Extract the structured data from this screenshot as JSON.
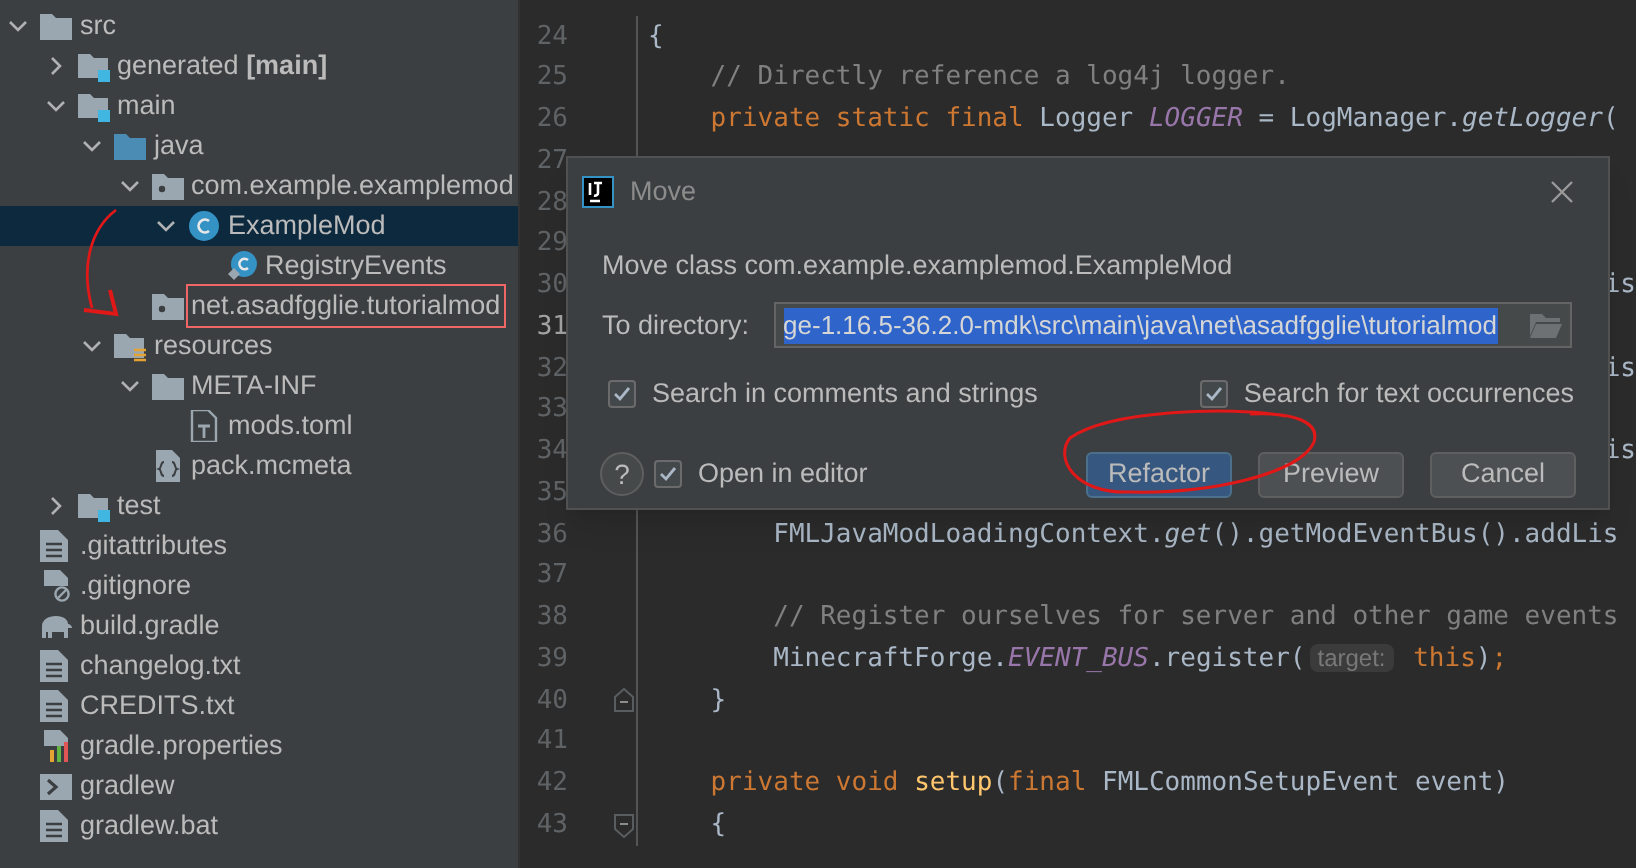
{
  "project_tree": [
    {
      "label": "src",
      "kind": "folder",
      "expanded": true,
      "selected": false,
      "children": [
        {
          "label": "generated **[main]**",
          "kind": "module_folder",
          "expanded": false,
          "selected": false
        },
        {
          "label": "main",
          "kind": "module_folder",
          "expanded": true,
          "selected": false,
          "children": [
            {
              "label": "java",
              "kind": "source_folder",
              "expanded": true,
              "selected": false,
              "children": [
                {
                  "label": "com.example.examplemod",
                  "kind": "package",
                  "expanded": true,
                  "selected": false,
                  "children": [
                    {
                      "label": "ExampleMod",
                      "kind": "class",
                      "expanded": true,
                      "selected": true,
                      "children": [
                        {
                          "label": "RegistryEvents",
                          "kind": "inner_class",
                          "selected": false
                        }
                      ]
                    }
                  ]
                },
                {
                  "label": "net.asadfgglie.tutorialmod",
                  "kind": "package",
                  "selected": false,
                  "annotated": true
                }
              ]
            },
            {
              "label": "resources",
              "kind": "resources_folder",
              "expanded": true,
              "selected": false,
              "children": [
                {
                  "label": "META-INF",
                  "kind": "folder",
                  "expanded": true,
                  "selected": false,
                  "children": [
                    {
                      "label": "mods.toml",
                      "kind": "toml_file",
                      "selected": false
                    }
                  ]
                },
                {
                  "label": "pack.mcmeta",
                  "kind": "json_file",
                  "selected": false
                }
              ]
            }
          ]
        },
        {
          "label": "test",
          "kind": "module_folder",
          "expanded": false,
          "selected": false
        }
      ]
    },
    {
      "label": ".gitattributes",
      "kind": "text_file",
      "selected": false
    },
    {
      "label": ".gitignore",
      "kind": "ignore_file",
      "selected": false
    },
    {
      "label": "build.gradle",
      "kind": "gradle_file",
      "selected": false
    },
    {
      "label": "changelog.txt",
      "kind": "text_file",
      "selected": false
    },
    {
      "label": "CREDITS.txt",
      "kind": "text_file",
      "selected": false
    },
    {
      "label": "gradle.properties",
      "kind": "properties_file",
      "selected": false
    },
    {
      "label": "gradlew",
      "kind": "script_file",
      "selected": false
    },
    {
      "label": "gradlew.bat",
      "kind": "text_file",
      "selected": false
    }
  ],
  "editor_lines": [
    {
      "number": "24",
      "current": false,
      "kind": "plain",
      "segments": [
        {
          "kind": "plain",
          "text": "{"
        }
      ]
    },
    {
      "number": "25",
      "current": false,
      "segments": [
        {
          "kind": "comment",
          "text": "    // Directly reference a log4j logger."
        }
      ]
    },
    {
      "number": "26",
      "current": false,
      "segments": [
        {
          "kind": "keyword",
          "text": "    private static final "
        },
        {
          "kind": "plain",
          "text": "Logger "
        },
        {
          "kind": "field",
          "text": "LOGGER"
        },
        {
          "kind": "plain",
          "text": " = LogManager."
        },
        {
          "kind": "method",
          "text": "getLogger"
        },
        {
          "kind": "plain",
          "text": "("
        }
      ]
    },
    {
      "number": "27",
      "current": false
    },
    {
      "number": "28",
      "current": false
    },
    {
      "number": "29",
      "current": false
    },
    {
      "number": "30",
      "current": false,
      "tail": "is"
    },
    {
      "number": "31",
      "current": true
    },
    {
      "number": "32",
      "current": false,
      "tail": "is"
    },
    {
      "number": "33",
      "current": false
    },
    {
      "number": "34",
      "current": false,
      "tail": "is"
    },
    {
      "number": "35",
      "current": false
    },
    {
      "number": "36",
      "current": false,
      "segments": [
        {
          "kind": "plain",
          "text": "        FMLJavaModLoadingContext."
        },
        {
          "kind": "method",
          "text": "get"
        },
        {
          "kind": "plain",
          "text": "().getModEventBus().addLis"
        }
      ]
    },
    {
      "number": "37",
      "current": false
    },
    {
      "number": "38",
      "current": false,
      "segments": [
        {
          "kind": "comment",
          "text": "        // Register ourselves for server and other game events"
        }
      ]
    },
    {
      "number": "39",
      "current": false,
      "segments": [
        {
          "kind": "plain",
          "text": "        MinecraftForge."
        },
        {
          "kind": "field",
          "text": "EVENT_BUS"
        },
        {
          "kind": "plain",
          "text": ".register("
        },
        {
          "kind": "hint",
          "text": "target:"
        },
        {
          "kind": "keyword",
          "text": " this"
        },
        {
          "kind": "plain",
          "text": ")"
        },
        {
          "kind": "keyword",
          "text": ";"
        }
      ]
    },
    {
      "number": "40",
      "current": false,
      "kind": "fold_end",
      "segments": [
        {
          "kind": "plain",
          "text": "    }"
        }
      ]
    },
    {
      "number": "41",
      "current": false
    },
    {
      "number": "42",
      "current": false,
      "segments": [
        {
          "kind": "keyword",
          "text": "    private void "
        },
        {
          "kind": "declaration",
          "text": "setup"
        },
        {
          "kind": "plain",
          "text": "("
        },
        {
          "kind": "keyword",
          "text": "final "
        },
        {
          "kind": "plain",
          "text": "FMLCommonSetupEvent event)"
        }
      ]
    },
    {
      "number": "43",
      "current": false,
      "kind": "fold_start",
      "segments": [
        {
          "kind": "plain",
          "text": "    {"
        }
      ]
    }
  ],
  "dialog": {
    "title": "Move",
    "message": "Move class com.example.examplemod.ExampleMod",
    "directory": {
      "label": "To directory:",
      "value": "ge-1.16.5-36.2.0-mdk\\src\\main\\java\\net\\asadfgglie\\tutorialmod"
    },
    "options": [
      {
        "label": "Search in comments and strings",
        "checked": true
      },
      {
        "label": "Search for text occurrences",
        "checked": true
      }
    ],
    "help": "?",
    "open_in_editor": {
      "label": "Open in editor",
      "checked": true
    },
    "buttons": [
      {
        "label": "Refactor",
        "kind": "primary"
      },
      {
        "label": "Preview",
        "kind": "secondary"
      },
      {
        "label": "Cancel",
        "kind": "secondary"
      }
    ]
  }
}
